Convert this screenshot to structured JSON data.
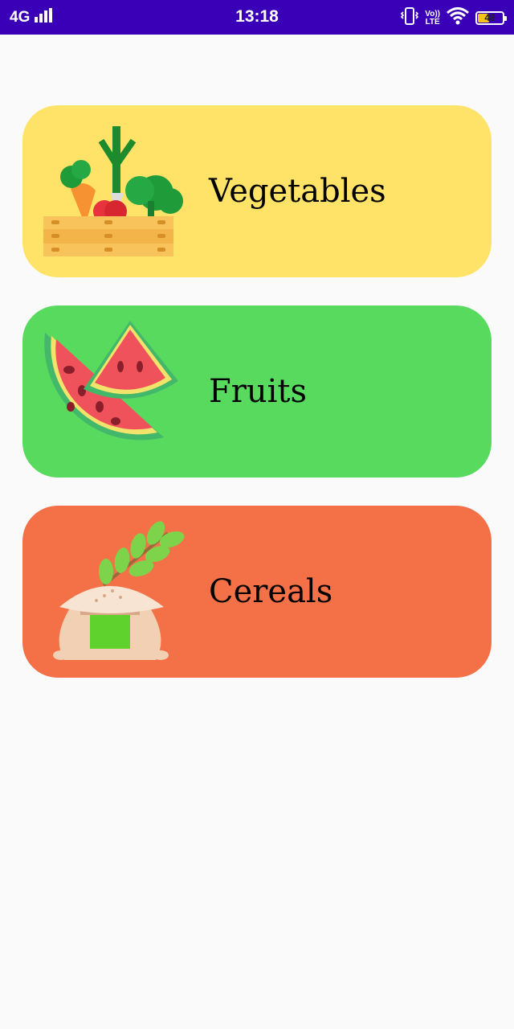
{
  "status_bar": {
    "network": "4G",
    "time": "13:18",
    "volte_top": "Vo))",
    "volte_bottom": "LTE",
    "battery_level": "48",
    "battery_percent": 48,
    "background_color": "#3a00b8"
  },
  "categories": [
    {
      "label": "Vegetables",
      "color": "#ffe268",
      "icon": "vegetable-crate-icon"
    },
    {
      "label": "Fruits",
      "color": "#57da5e",
      "icon": "watermelon-icon"
    },
    {
      "label": "Cereals",
      "color": "#f47148",
      "icon": "grain-sack-icon"
    }
  ]
}
